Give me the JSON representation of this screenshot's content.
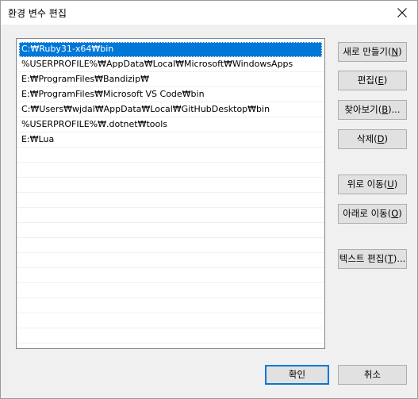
{
  "window": {
    "title": "환경 변수 편집"
  },
  "paths": {
    "items": [
      "C:₩Ruby31-x64₩bin",
      "%USERPROFILE%₩AppData₩Local₩Microsoft₩WindowsApps",
      "E:₩ProgramFiles₩Bandizip₩",
      "E:₩ProgramFiles₩Microsoft VS Code₩bin",
      "C:₩Users₩wjdal₩AppData₩Local₩GitHubDesktop₩bin",
      "%USERPROFILE%₩.dotnet₩tools",
      "E:₩Lua"
    ],
    "selected_index": 0,
    "empty_rows": 13
  },
  "buttons": {
    "new": {
      "label": "새로 만들기(",
      "mnemonic": "N",
      "suffix": ")"
    },
    "edit": {
      "label": "편집(",
      "mnemonic": "E",
      "suffix": ")"
    },
    "browse": {
      "label": "찾아보기(",
      "mnemonic": "B",
      "suffix": ")..."
    },
    "delete": {
      "label": "삭제(",
      "mnemonic": "D",
      "suffix": ")"
    },
    "move_up": {
      "label": "위로 이동(",
      "mnemonic": "U",
      "suffix": ")"
    },
    "move_down": {
      "label": "아래로 이동(",
      "mnemonic": "O",
      "suffix": ")"
    },
    "edit_text": {
      "label": "텍스트 편집(",
      "mnemonic": "T",
      "suffix": ")..."
    },
    "ok": {
      "label": "확인"
    },
    "cancel": {
      "label": "취소"
    }
  },
  "colors": {
    "selection": "#0078d7",
    "accent_border": "#0078d7"
  }
}
